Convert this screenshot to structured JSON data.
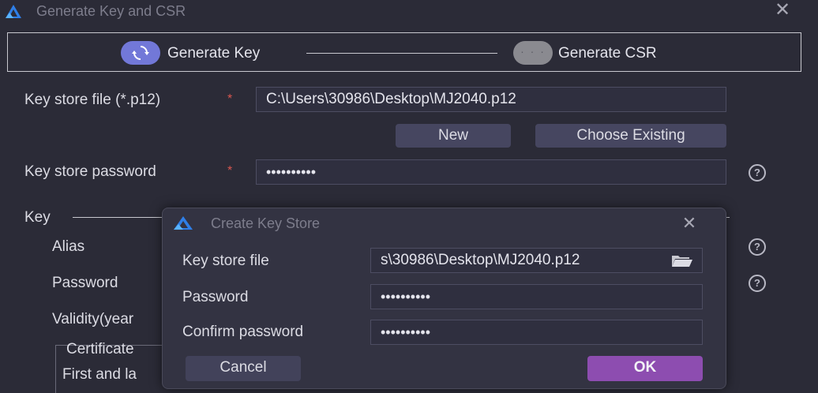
{
  "window": {
    "title": "Generate Key and CSR",
    "close_icon": "close-icon"
  },
  "steps": [
    {
      "label": "Generate Key",
      "icon": "sync-icon",
      "state": "active"
    },
    {
      "label": "Generate CSR",
      "icon": "more-dots-icon",
      "state": "pending"
    }
  ],
  "form": {
    "keystore_file_label": "Key store file (*.p12)",
    "keystore_file_value": "C:\\Users\\30986\\Desktop\\MJ2040.p12",
    "new_button": "New",
    "choose_existing_button": "Choose Existing",
    "keystore_password_label": "Key store password",
    "keystore_password_value": "••••••••••",
    "required_mark": "*",
    "help_glyph": "?"
  },
  "key_section": {
    "title": "Key",
    "alias_label": "Alias",
    "password_label": "Password",
    "validity_label": "Validity(year",
    "certificate_label": "Certificate",
    "first_last_label": "First and la"
  },
  "dialog": {
    "title": "Create Key Store",
    "keystore_file_label": "Key store file",
    "keystore_file_value": "s\\30986\\Desktop\\MJ2040.p12",
    "password_label": "Password",
    "password_value": "••••••••••",
    "confirm_label": "Confirm password",
    "confirm_value": "••••••••••",
    "cancel_button": "Cancel",
    "ok_button": "OK"
  },
  "colors": {
    "background": "#2b2b37",
    "accent": "#7278d8",
    "ok_button": "#8d4db0",
    "required": "#d8564f"
  }
}
